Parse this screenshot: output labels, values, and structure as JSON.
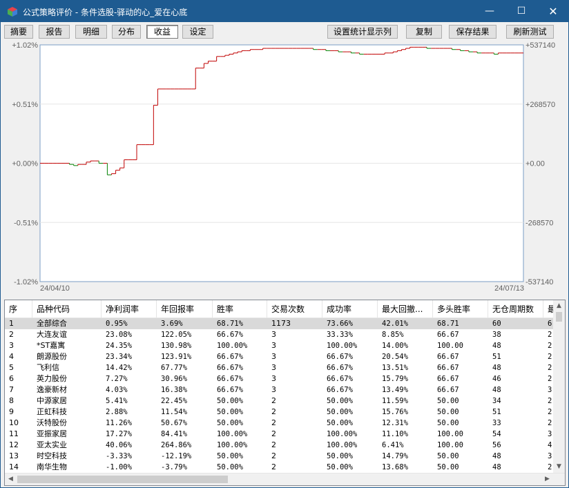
{
  "window": {
    "title": "公式策略评价 - 条件选股-驿动的心_爱在心底",
    "minimize_icon": "minimize-icon",
    "maximize_icon": "maximize-icon",
    "close_icon": "close-icon",
    "minimize_glyph": "—",
    "maximize_glyph": "☐",
    "close_glyph": "✕"
  },
  "toolbar": {
    "tabs": [
      "摘要",
      "报告",
      "明细",
      "分布",
      "收益",
      "设定"
    ],
    "active_tab": "收益",
    "buttons": [
      "设置统计显示列",
      "复制",
      "保存结果",
      "刷新测试"
    ]
  },
  "chart_data": {
    "type": "line",
    "left_axis_ticks": [
      "+1.02%",
      "+0.51%",
      "+0.00%",
      "-0.51%",
      "-1.02%"
    ],
    "right_axis_ticks": [
      "+537140",
      "+268570",
      "+0.00",
      "-268570",
      "-537140"
    ],
    "x_start_label": "24/04/10",
    "x_end_label": "24/07/13",
    "ylim": [
      -1.02,
      1.02
    ],
    "step": true,
    "series": [
      {
        "values": [
          0.0,
          0.0,
          0.0,
          0.0,
          0.0,
          0.0,
          0.0,
          -0.01,
          -0.02,
          -0.01,
          -0.01,
          0.01,
          0.02,
          0.02,
          0.0,
          0.0,
          -0.1,
          -0.09,
          -0.06,
          -0.04,
          0.03,
          0.03,
          0.03,
          0.16,
          0.16,
          0.16,
          0.16,
          0.5,
          0.64,
          0.64,
          0.64,
          0.64,
          0.64,
          0.64,
          0.64,
          0.64,
          0.64,
          0.82,
          0.82,
          0.86,
          0.88,
          0.88,
          0.92,
          0.92,
          0.93,
          0.94,
          0.95,
          0.96,
          0.97,
          0.97,
          0.98,
          0.98,
          0.98,
          0.99,
          0.99,
          0.99,
          0.99,
          0.99,
          0.99,
          0.99,
          0.99,
          0.99,
          0.99,
          0.99,
          0.99,
          0.98,
          0.98,
          0.98,
          0.97,
          0.97,
          0.97,
          0.96,
          0.96,
          0.96,
          0.95,
          0.95,
          0.94,
          0.94,
          0.94,
          0.94,
          0.94,
          0.94,
          0.95,
          0.95,
          0.96,
          0.97,
          0.98,
          0.99,
          1.0,
          1.0,
          1.0,
          1.0,
          0.99,
          0.99,
          0.99,
          0.99,
          0.99,
          0.99,
          0.98,
          0.98,
          0.97,
          0.97,
          0.96,
          0.96,
          0.95,
          0.95,
          0.95,
          0.95,
          0.94,
          0.95,
          0.95,
          0.95,
          0.95,
          0.95,
          0.95
        ],
        "colors": {
          "up": "#c00000",
          "down": "#008000"
        }
      }
    ],
    "grid": true
  },
  "table": {
    "columns": [
      "序",
      "品种代码",
      "净利润率",
      "年回报率",
      "胜率",
      "交易次数",
      "成功率",
      "最大回撤...",
      "多头胜率",
      "无仓周期数",
      "最"
    ],
    "rows": [
      [
        "1",
        "全部综合",
        "0.95%",
        "3.69%",
        "68.71%",
        "1173",
        "73.66%",
        "42.01%",
        "68.71",
        "60",
        "6"
      ],
      [
        "2",
        "大连友谊",
        "23.08%",
        "122.05%",
        "66.67%",
        "3",
        "33.33%",
        "8.85%",
        "66.67",
        "38",
        "2"
      ],
      [
        "3",
        "*ST嘉寓",
        "24.35%",
        "130.98%",
        "100.00%",
        "3",
        "100.00%",
        "14.00%",
        "100.00",
        "48",
        "2"
      ],
      [
        "4",
        "朗源股份",
        "23.34%",
        "123.91%",
        "66.67%",
        "3",
        "66.67%",
        "20.54%",
        "66.67",
        "51",
        "2"
      ],
      [
        "5",
        "飞利信",
        "14.42%",
        "67.77%",
        "66.67%",
        "3",
        "66.67%",
        "13.51%",
        "66.67",
        "48",
        "2"
      ],
      [
        "6",
        "英力股份",
        "7.27%",
        "30.96%",
        "66.67%",
        "3",
        "66.67%",
        "15.79%",
        "66.67",
        "46",
        "2"
      ],
      [
        "7",
        "逸豪新材",
        "4.03%",
        "16.38%",
        "66.67%",
        "3",
        "66.67%",
        "13.49%",
        "66.67",
        "48",
        "3"
      ],
      [
        "8",
        "中源家居",
        "5.41%",
        "22.45%",
        "50.00%",
        "2",
        "50.00%",
        "11.59%",
        "50.00",
        "34",
        "2"
      ],
      [
        "9",
        "正虹科技",
        "2.88%",
        "11.54%",
        "50.00%",
        "2",
        "50.00%",
        "15.76%",
        "50.00",
        "51",
        "2"
      ],
      [
        "10",
        "沃特股份",
        "11.26%",
        "50.67%",
        "50.00%",
        "2",
        "50.00%",
        "12.31%",
        "50.00",
        "33",
        "2"
      ],
      [
        "11",
        "亚振家居",
        "17.27%",
        "84.41%",
        "100.00%",
        "2",
        "100.00%",
        "11.10%",
        "100.00",
        "54",
        "3"
      ],
      [
        "12",
        "亚太实业",
        "40.06%",
        "264.86%",
        "100.00%",
        "2",
        "100.00%",
        "6.41%",
        "100.00",
        "56",
        "4"
      ],
      [
        "13",
        "时空科技",
        "-3.33%",
        "-12.19%",
        "50.00%",
        "2",
        "50.00%",
        "14.79%",
        "50.00",
        "48",
        "3"
      ],
      [
        "14",
        "南华生物",
        "-1.00%",
        "-3.79%",
        "50.00%",
        "2",
        "50.00%",
        "13.68%",
        "50.00",
        "48",
        "2"
      ]
    ],
    "selected_row": 0
  },
  "scrollbars": {
    "left_arrow": "◀",
    "right_arrow": "▶",
    "up_arrow": "▲",
    "down_arrow": "▼"
  }
}
